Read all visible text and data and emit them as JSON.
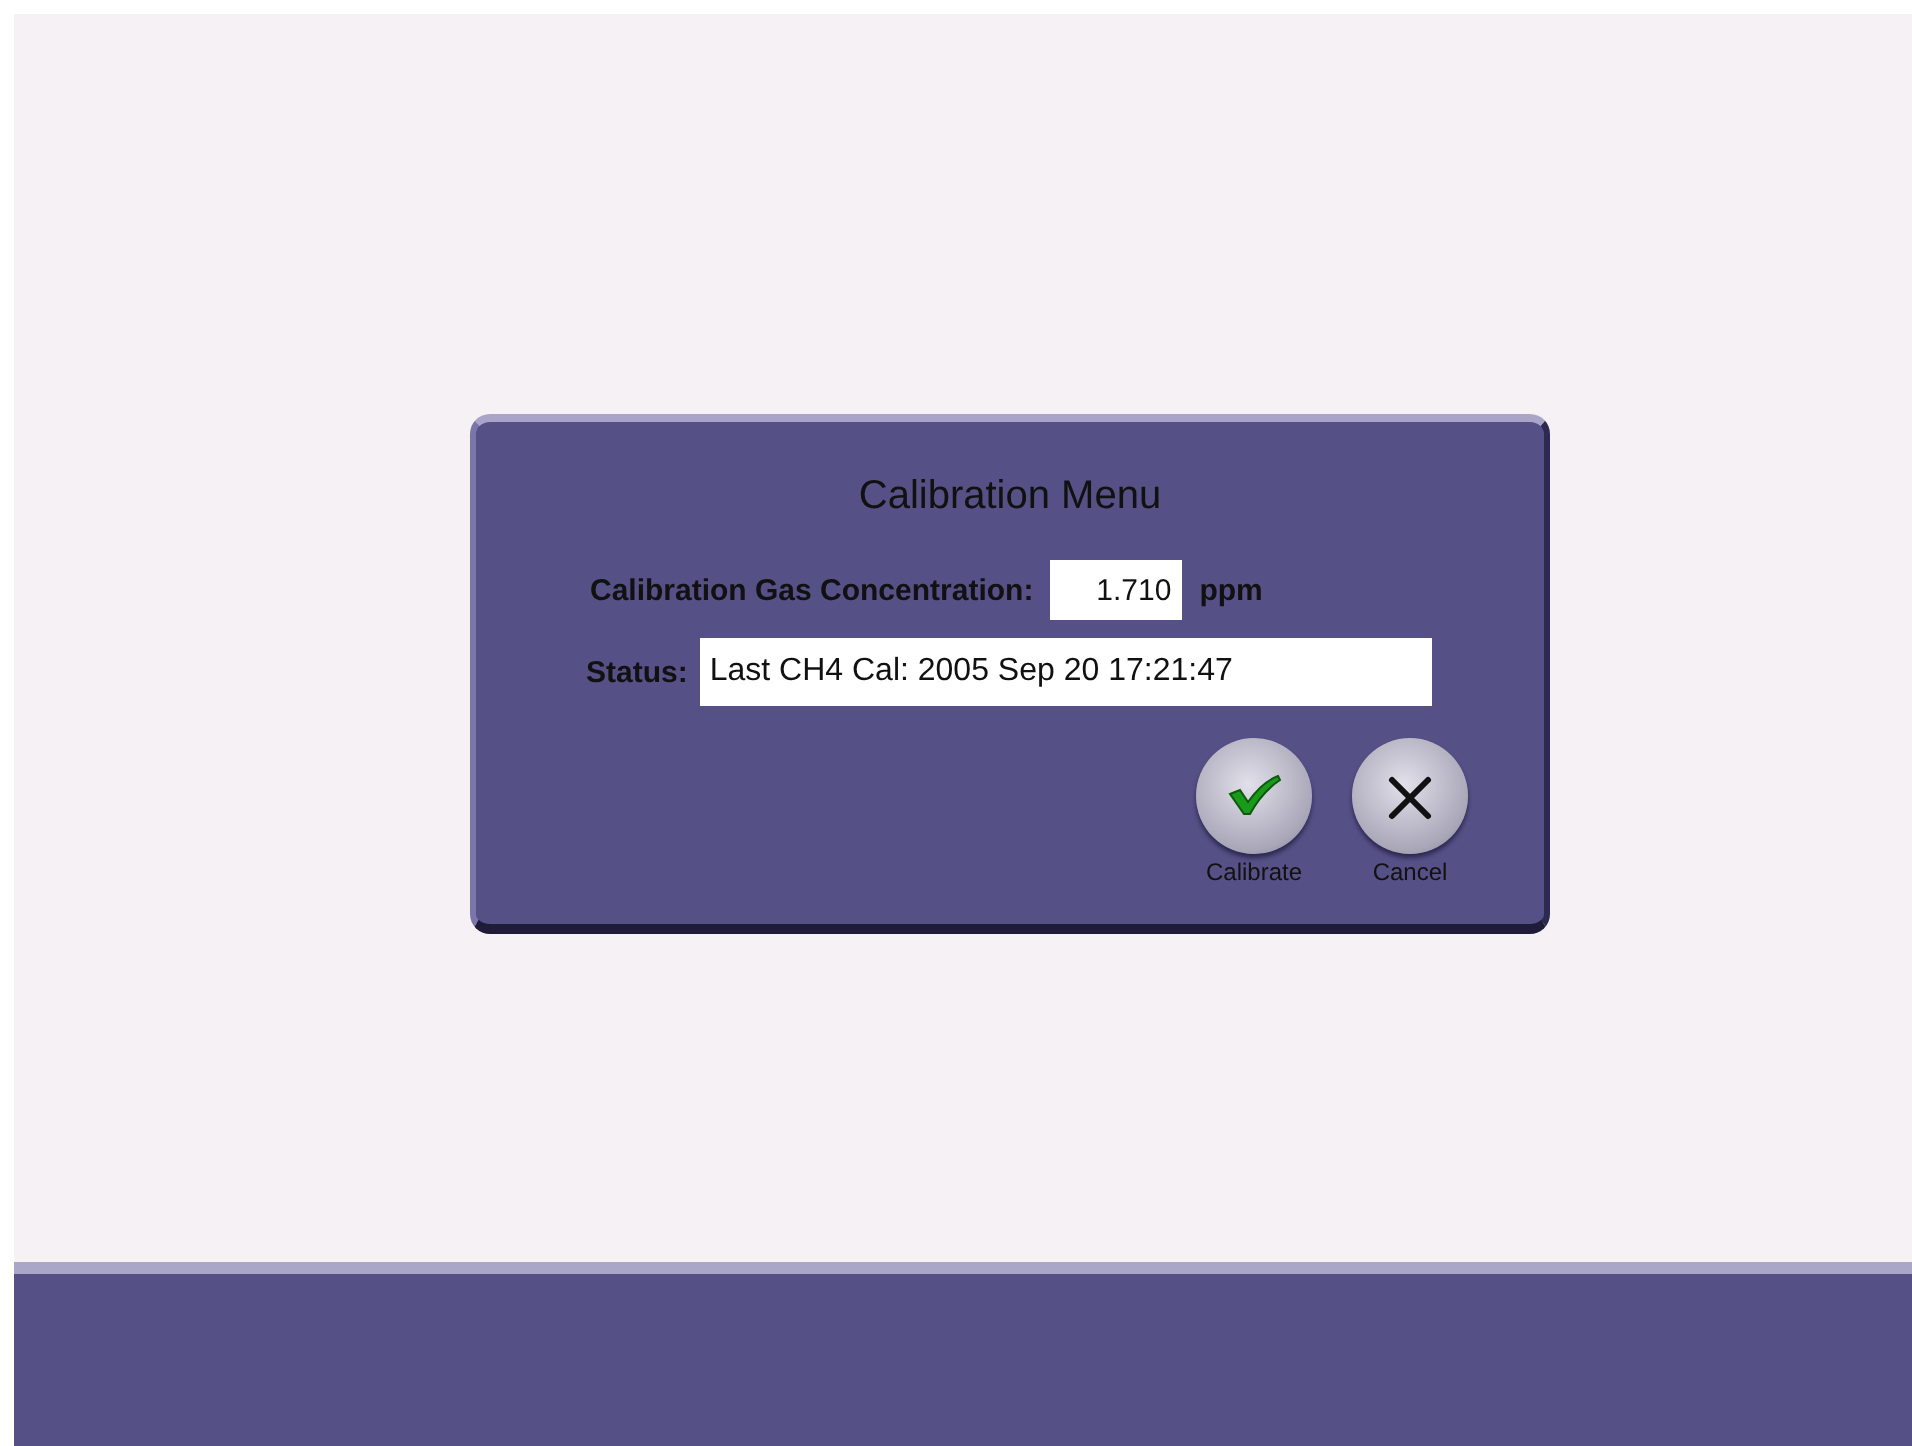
{
  "dialog": {
    "title": "Calibration Menu",
    "concentration": {
      "label": "Calibration Gas Concentration:",
      "value": "1.710",
      "unit": "ppm"
    },
    "status": {
      "label": "Status:",
      "value": "Last CH4 Cal: 2005 Sep 20 17:21:47"
    },
    "buttons": [
      {
        "kind": "confirm",
        "label": "Calibrate"
      },
      {
        "kind": "cancel",
        "label": "Cancel"
      }
    ]
  }
}
